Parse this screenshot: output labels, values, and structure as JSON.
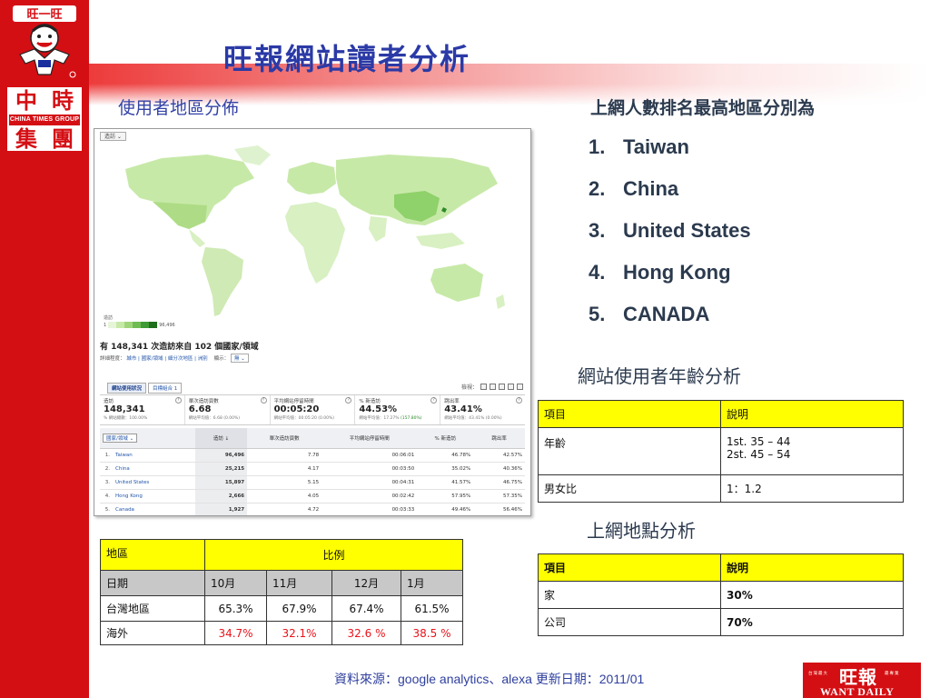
{
  "slide_title": "旺報網站讀者分析",
  "map_caption": "使用者地區分佈",
  "brand": {
    "mascot_text": "旺一旺",
    "ct_logo": {
      "c1": "中",
      "c2": "時",
      "c3": "集",
      "c4": "團",
      "en": "CHINA TIMES GROUP"
    },
    "want_logo": {
      "cn": "旺報",
      "en": "WANT DAILY",
      "tagline_left": "台灣最大",
      "tagline_right": "最專業"
    },
    "colors": {
      "red": "#d40f14",
      "title_blue": "#2b3aa6",
      "yellow": "#ffff00",
      "highlight_red": "#e8141b",
      "map_green": "#8fd16a"
    }
  },
  "analytics": {
    "tab_label": "造訪 ⌄",
    "map_key_label": "造訪",
    "map_key_min": "1",
    "map_key_max": "96,496",
    "visits_title": "有 148,341 次造訪來自 102 個國家/領域",
    "detail_label": "詳細程度：",
    "detail_links": "城市 | 國家/領域 | 細分次地區 | 洲別",
    "show_label": "顯示：",
    "show_value": "無 ⌄",
    "tab_usage": "網站使用狀況",
    "tab_goals": "目標組合 1",
    "view_label": "檢視：",
    "summary": [
      {
        "k": "造訪",
        "v": "148,341",
        "s": "% 網站總數：100.00%"
      },
      {
        "k": "單次造訪頁數",
        "v": "6.68",
        "s": "網站平均值：6.68 (0.00%)"
      },
      {
        "k": "平均網站停留時間",
        "v": "00:05:20",
        "s": "網站平均值：00:05:20 (0.00%)"
      },
      {
        "k": "% 新造訪",
        "v": "44.53%",
        "s": "網站平均值：17.27%",
        "s2": " (157.80%)"
      },
      {
        "k": "跳出率",
        "v": "43.41%",
        "s": "網站平均值：43.41% (0.00%)"
      }
    ],
    "dimension_label": "國家/領域 ⌄",
    "columns": [
      "造訪 ↓",
      "單次造訪頁數",
      "平均網站停留時間",
      "% 新造訪",
      "跳出率"
    ],
    "rows": [
      {
        "idx": "1.",
        "country": "Taiwan",
        "visits": "96,496",
        "pages": "7.78",
        "time": "00:06:01",
        "new": "46.78%",
        "bounce": "42.57%"
      },
      {
        "idx": "2.",
        "country": "China",
        "visits": "25,215",
        "pages": "4.17",
        "time": "00:03:50",
        "new": "35.02%",
        "bounce": "40.36%"
      },
      {
        "idx": "3.",
        "country": "United States",
        "visits": "15,897",
        "pages": "5.15",
        "time": "00:04:31",
        "new": "41.57%",
        "bounce": "46.75%"
      },
      {
        "idx": "4.",
        "country": "Hong Kong",
        "visits": "2,666",
        "pages": "4.05",
        "time": "00:02:42",
        "new": "57.95%",
        "bounce": "57.35%"
      },
      {
        "idx": "5.",
        "country": "Canada",
        "visits": "1,927",
        "pages": "4.72",
        "time": "00:03:33",
        "new": "49.46%",
        "bounce": "56.46%"
      }
    ]
  },
  "ranking": {
    "title": "上網人數排名最高地區分別為",
    "items": [
      {
        "n": "1.",
        "label": "Taiwan"
      },
      {
        "n": "2.",
        "label": "China"
      },
      {
        "n": "3.",
        "label": "United States"
      },
      {
        "n": "4.",
        "label": "Hong Kong"
      },
      {
        "n": "5.",
        "label": "CANADA"
      }
    ]
  },
  "age_section": {
    "title": "網站使用者年齡分析",
    "head": [
      "項目",
      "說明"
    ],
    "age_label": "年齡",
    "age_line1": "1st. 35 – 44",
    "age_line2": "2st. 45 – 54",
    "gender_label": "男女比",
    "gender_value": "1：1.2"
  },
  "location_section": {
    "title": "上網地點分析",
    "head": [
      "項目",
      "說明"
    ],
    "rows": [
      {
        "label": "家",
        "value": "30%"
      },
      {
        "label": "公司",
        "value": "70%"
      }
    ]
  },
  "region_table": {
    "header_region": "地區",
    "header_ratio": "比例",
    "date_label": "日期",
    "months": [
      "10月",
      "11月",
      "12月",
      "1月"
    ],
    "taiwan_label": "台灣地區",
    "taiwan_values": [
      "65.3%",
      "67.9%",
      "67.4%",
      "61.5%"
    ],
    "overseas_label": "海外",
    "overseas_values": [
      "34.7%",
      "32.1%",
      "32.6 %",
      "38.5 %"
    ]
  },
  "source_text": "資料來源：google analytics、alexa  更新日期：2011/01"
}
